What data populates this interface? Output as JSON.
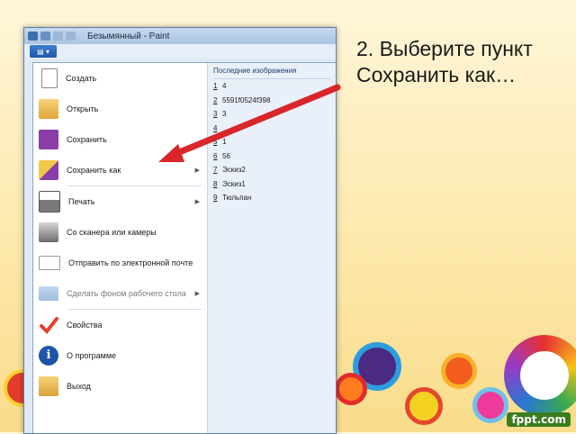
{
  "window": {
    "title": "Безымянный - Paint"
  },
  "menu": {
    "items": [
      {
        "label": "Создать",
        "submenu": false,
        "icon": "new-document-icon"
      },
      {
        "label": "Открыть",
        "submenu": false,
        "icon": "open-folder-icon"
      },
      {
        "label": "Сохранить",
        "submenu": false,
        "icon": "floppy-disk-icon"
      },
      {
        "label": "Сохранить как",
        "submenu": true,
        "icon": "save-as-icon"
      },
      {
        "label": "Печать",
        "submenu": true,
        "icon": "printer-icon"
      },
      {
        "label": "Со сканера или камеры",
        "submenu": false,
        "icon": "scanner-icon"
      },
      {
        "label": "Отправить по электронной почте",
        "submenu": false,
        "icon": "email-icon"
      },
      {
        "label": "Сделать фоном рабочего стола",
        "submenu": true,
        "icon": "desktop-background-icon"
      },
      {
        "label": "Свойства",
        "submenu": false,
        "icon": "checkmark-icon"
      },
      {
        "label": "О программе",
        "submenu": false,
        "icon": "info-icon"
      },
      {
        "label": "Выход",
        "submenu": false,
        "icon": "exit-icon"
      }
    ]
  },
  "recent": {
    "header": "Последние изображения",
    "items": [
      {
        "num": "1",
        "name": "4"
      },
      {
        "num": "2",
        "name": "5591f0524f398"
      },
      {
        "num": "3",
        "name": "3"
      },
      {
        "num": "4",
        "name": ""
      },
      {
        "num": "5",
        "name": "1"
      },
      {
        "num": "6",
        "name": "56"
      },
      {
        "num": "7",
        "name": "Эскиз2"
      },
      {
        "num": "8",
        "name": "Эскиз1"
      },
      {
        "num": "9",
        "name": "Тюльпан"
      }
    ]
  },
  "caption": {
    "line1": "2. Выберите пункт",
    "line2": "Сохранить как…"
  },
  "branding": {
    "text": "fppt.com"
  },
  "colors": {
    "pointer_arrow": "#d8262b",
    "menu_highlight": "#1c58a8"
  }
}
